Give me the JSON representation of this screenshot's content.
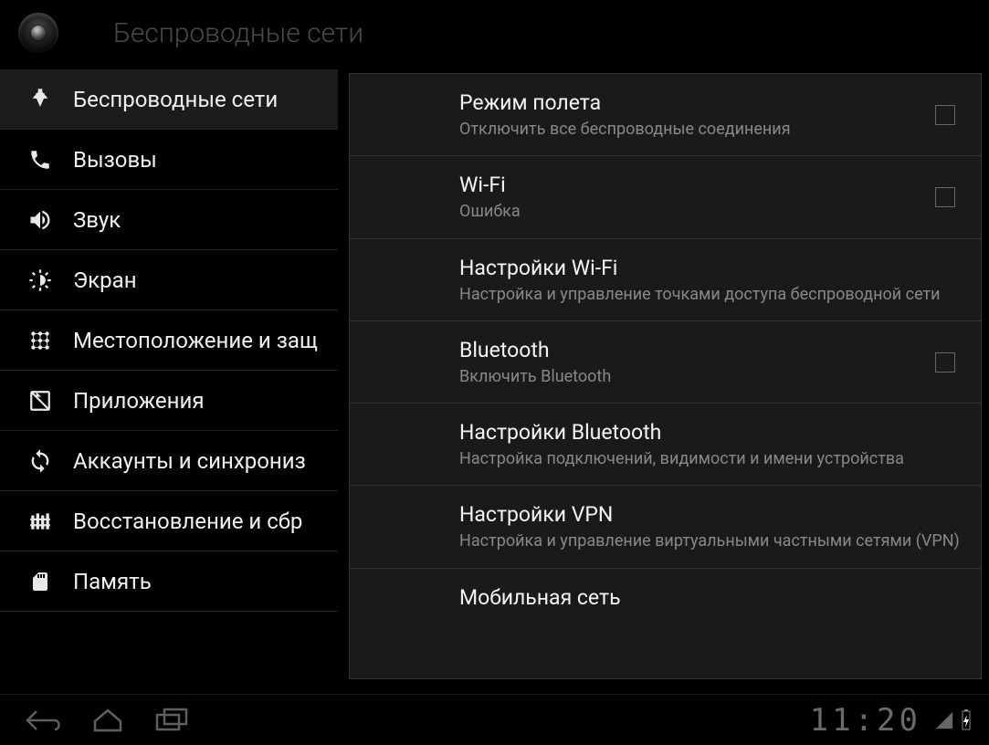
{
  "header": {
    "title": "Беспроводные сети"
  },
  "sidebar": {
    "items": [
      {
        "icon": "wifi",
        "label": "Беспроводные сети",
        "active": true
      },
      {
        "icon": "phone",
        "label": "Вызовы"
      },
      {
        "icon": "sound",
        "label": "Звук"
      },
      {
        "icon": "display",
        "label": "Экран"
      },
      {
        "icon": "location",
        "label": "Местоположение и защ"
      },
      {
        "icon": "apps",
        "label": "Приложения"
      },
      {
        "icon": "sync",
        "label": "Аккаунты и синхрониз"
      },
      {
        "icon": "reset",
        "label": "Восстановление и сбр"
      },
      {
        "icon": "storage",
        "label": "Память"
      }
    ]
  },
  "panel": {
    "items": [
      {
        "title": "Режим полета",
        "sub": "Отключить все беспроводные соединения",
        "checkbox": true
      },
      {
        "title": "Wi-Fi",
        "sub": "Ошибка",
        "checkbox": true
      },
      {
        "title": "Настройки Wi-Fi",
        "sub": "Настройка и управление точками доступа беспроводной сети"
      },
      {
        "title": "Bluetooth",
        "sub": "Включить Bluetooth",
        "checkbox": true
      },
      {
        "title": "Настройки Bluetooth",
        "sub": "Настройка подключений, видимости и имени устройства"
      },
      {
        "title": "Настройки VPN",
        "sub": "Настройка и управление виртуальными частными сетями (VPN)"
      },
      {
        "title": "Мобильная сеть",
        "sub": ""
      }
    ]
  },
  "sysbar": {
    "clock": "11:20"
  }
}
